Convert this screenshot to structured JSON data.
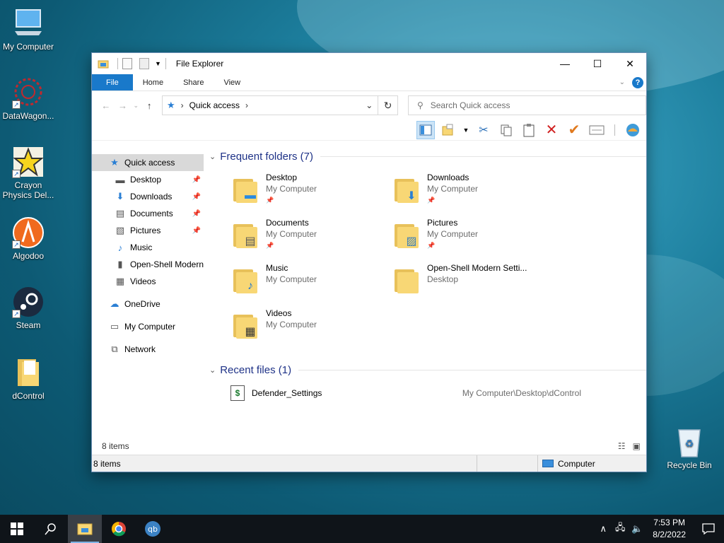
{
  "desktop": {
    "icons": [
      {
        "label": "My Computer",
        "icon": "computer-icon"
      },
      {
        "label": "DataWagon...",
        "icon": "datawagon-icon"
      },
      {
        "label": "Crayon Physics Del...",
        "icon": "crayon-star-icon"
      },
      {
        "label": "Algodoo",
        "icon": "algodoo-icon"
      },
      {
        "label": "Steam",
        "icon": "steam-icon"
      },
      {
        "label": "dControl",
        "icon": "folder-icon"
      },
      {
        "label": "Recycle Bin",
        "icon": "recycle-bin-icon"
      }
    ]
  },
  "window": {
    "title": "File Explorer",
    "controls": {
      "minimize": "—",
      "maximize": "☐",
      "close": "✕"
    },
    "ribbon_tabs": [
      "File",
      "Home",
      "Share",
      "View"
    ],
    "help": "?",
    "address": {
      "location": "Quick access",
      "icon": "quick-access-star-icon"
    },
    "search_placeholder": "Search Quick access",
    "nav": [
      {
        "label": "Quick access",
        "icon": "★",
        "type": "top",
        "selected": true
      },
      {
        "label": "Desktop",
        "icon": "▬",
        "type": "sub",
        "pinned": true
      },
      {
        "label": "Downloads",
        "icon": "⬇",
        "type": "sub",
        "pinned": true
      },
      {
        "label": "Documents",
        "icon": "▤",
        "type": "sub",
        "pinned": true
      },
      {
        "label": "Pictures",
        "icon": "▧",
        "type": "sub",
        "pinned": true
      },
      {
        "label": "Music",
        "icon": "♪",
        "type": "sub",
        "pinned": false
      },
      {
        "label": "Open-Shell Modern",
        "icon": "▮",
        "type": "sub",
        "pinned": false
      },
      {
        "label": "Videos",
        "icon": "▦",
        "type": "sub",
        "pinned": false
      },
      {
        "label": "OneDrive",
        "icon": "☁",
        "type": "top",
        "pinned": false
      },
      {
        "label": "My Computer",
        "icon": "▭",
        "type": "top",
        "pinned": false
      },
      {
        "label": "Network",
        "icon": "⧉",
        "type": "top",
        "pinned": false
      }
    ],
    "frequent": {
      "heading": "Frequent folders (7)",
      "folders": [
        {
          "name": "Desktop",
          "location": "My Computer",
          "pinned": true,
          "emblem": "▬",
          "emblem_color": "#2a8be0"
        },
        {
          "name": "Downloads",
          "location": "My Computer",
          "pinned": true,
          "emblem": "⬇",
          "emblem_color": "#2a7fd4"
        },
        {
          "name": "Documents",
          "location": "My Computer",
          "pinned": true,
          "emblem": "▤",
          "emblem_color": "#555555"
        },
        {
          "name": "Pictures",
          "location": "My Computer",
          "pinned": true,
          "emblem": "▨",
          "emblem_color": "#3b7fb8"
        },
        {
          "name": "Music",
          "location": "My Computer",
          "pinned": false,
          "emblem": "♪",
          "emblem_color": "#1f78d1"
        },
        {
          "name": "Open-Shell Modern Setti...",
          "location": "Desktop",
          "pinned": false,
          "emblem": "",
          "emblem_color": "#000000"
        },
        {
          "name": "Videos",
          "location": "My Computer",
          "pinned": false,
          "emblem": "▦",
          "emblem_color": "#333333"
        }
      ]
    },
    "recent": {
      "heading": "Recent files (1)",
      "files": [
        {
          "name": "Defender_Settings",
          "path": "My Computer\\Desktop\\dControl"
        }
      ]
    },
    "inner_status": "8 items",
    "status_items": "8 items",
    "status_location": "Computer"
  },
  "taskbar": {
    "time": "7:53 PM",
    "date": "8/2/2022",
    "apps": [
      {
        "name": "start",
        "glyph": "⊞"
      },
      {
        "name": "search",
        "glyph": "⚲"
      },
      {
        "name": "file-explorer",
        "glyph": "▬"
      },
      {
        "name": "chrome",
        "glyph": "◉"
      },
      {
        "name": "qbittorrent",
        "glyph": "qb"
      }
    ]
  }
}
